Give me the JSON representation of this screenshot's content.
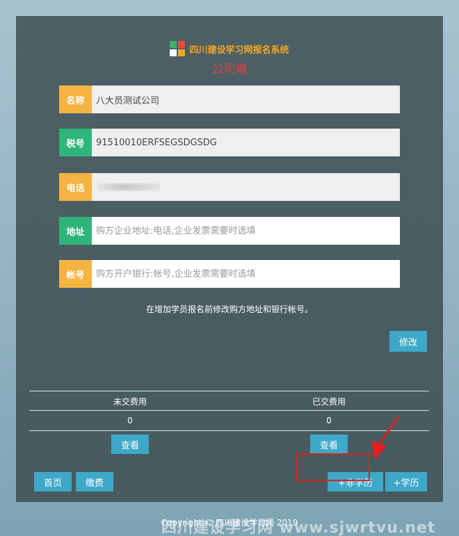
{
  "header": {
    "system_title": "四川建设学习网报名系统",
    "subtitle": "公司端"
  },
  "form": {
    "name": {
      "label": "名称",
      "value": "八大员测试公司"
    },
    "tax": {
      "label": "税号",
      "value": "91510010ERFSEGSDGSDG"
    },
    "phone": {
      "label": "电话",
      "value": ""
    },
    "address": {
      "label": "地址",
      "placeholder": "购方企业地址:电话,企业发票需要时选填"
    },
    "account": {
      "label": "帐号",
      "placeholder": "购方开户银行:帐号,企业发票需要时选填"
    }
  },
  "notice": "在增加学员报名前修改购方地址和银行帐号。",
  "buttons": {
    "modify": "修改",
    "view_unpaid": "查看",
    "view_paid": "查看",
    "home": "首页",
    "pay": "缴费",
    "add_non_degree": "+非学历",
    "add_degree": "+学历"
  },
  "stats": {
    "unpaid_header": "未交费用",
    "paid_header": "已交费用",
    "unpaid_value": "0",
    "paid_value": "0"
  },
  "footer": {
    "copyright": "Copyright © 四川建设学习网 2019"
  },
  "watermark": "四川建设学习网 www.sjwrtvu.net",
  "colors": {
    "panel": "#4c6066",
    "label_orange": "#f5b342",
    "label_green": "#2fb57a",
    "button": "#3ea8c8",
    "subtitle": "#e8403c",
    "annotation": "#e02020"
  }
}
